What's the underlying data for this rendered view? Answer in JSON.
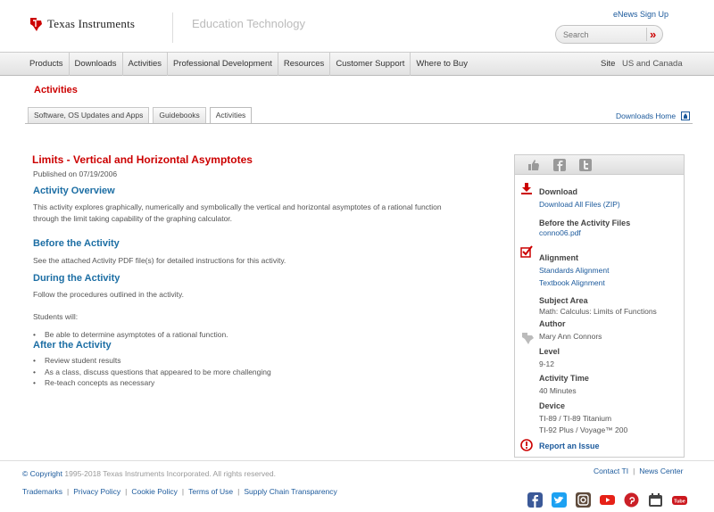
{
  "header": {
    "brand": "Texas Instruments",
    "section": "Education Technology",
    "enews_link": "eNews Sign Up",
    "search_placeholder": "Search",
    "search_go": "»"
  },
  "nav": {
    "items": [
      "Products",
      "Downloads",
      "Activities",
      "Professional Development",
      "Resources",
      "Customer Support",
      "Where to Buy"
    ],
    "site_label": "Site",
    "site_value": "US and Canada"
  },
  "page": {
    "title": "Activities",
    "tabs": [
      "Software, OS Updates and Apps",
      "Guidebooks",
      "Activities"
    ],
    "active_tab": "Activities",
    "downloads_home": "Downloads Home"
  },
  "activity": {
    "title": "Limits - Vertical and Horizontal Asymptotes",
    "published": "Published on 07/19/2006",
    "overview_heading": "Activity Overview",
    "overview_text": "This activity explores graphically, numerically and symbolically the vertical and horizontal asymptotes of a rational function through the limit taking capability of the graphing calculator.",
    "before_heading": "Before the Activity",
    "before_text": "See the attached Activity PDF file(s) for detailed instructions for this activity.",
    "during_heading": "During the Activity",
    "during_text": "Follow the procedures outlined in the activity.",
    "students_will": "Students will:",
    "students_bullets": [
      "Be able to determine asymptotes of a rational function."
    ],
    "after_heading": "After the Activity",
    "after_bullets": [
      "Review student results",
      "As a class, discuss questions that appeared to be more challenging",
      "Re-teach concepts as necessary"
    ]
  },
  "sidebar": {
    "download_title": "Download",
    "download_all": "Download All Files (ZIP)",
    "before_files_title": "Before the Activity Files",
    "before_file": "conno06.pdf",
    "alignment_title": "Alignment",
    "standards_alignment": "Standards Alignment",
    "textbook_alignment": "Textbook Alignment",
    "subject_area_title": "Subject Area",
    "subject_area": "Math: Calculus: Limits of Functions",
    "author_title": "Author",
    "author": "Mary Ann Connors",
    "level_title": "Level",
    "level": "9-12",
    "activity_time_title": "Activity Time",
    "activity_time": "40 Minutes",
    "device_title": "Device",
    "devices": [
      "TI-89 / TI-89 Titanium",
      "TI-92 Plus / Voyage™ 200"
    ],
    "report_issue": "Report an Issue"
  },
  "footer": {
    "copyright_link": "© Copyright",
    "copyright_text": "1995-2018 Texas Instruments Incorporated. All rights reserved.",
    "contact": "Contact TI",
    "news_center": "News Center",
    "links": [
      "Trademarks",
      "Privacy Policy",
      "Cookie Policy",
      "Terms of Use",
      "Supply Chain Transparency"
    ],
    "separator": "|"
  },
  "colors": {
    "brand_red": "#cc0000",
    "link_blue": "#1c5a9c",
    "heading_blue": "#1c6ea4"
  }
}
